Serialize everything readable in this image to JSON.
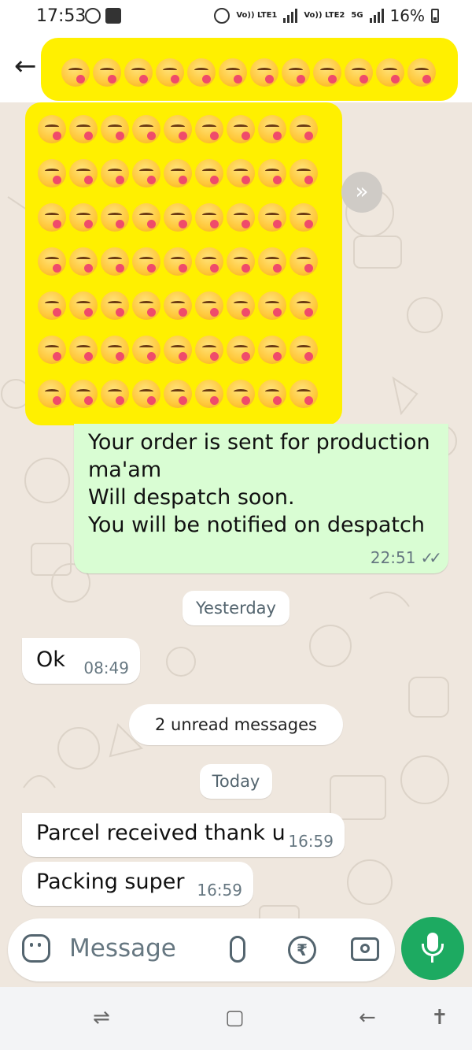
{
  "status_bar": {
    "time": "17:53",
    "sim1_label": "Vo)) LTE1",
    "sim2_label": "Vo)) LTE2",
    "network": "5G",
    "battery": "16%"
  },
  "header": {
    "back_icon": "arrow-left-icon"
  },
  "messages": {
    "outgoing_1": {
      "lines": [
        "Your order is sent for production",
        "ma'am",
        "Will despatch soon.",
        "You will be notified on despatch"
      ],
      "time": "22:51"
    },
    "yesterday_label": "Yesterday",
    "incoming_ok": {
      "text": "Ok",
      "time": "08:49"
    },
    "unread_label": "2 unread messages",
    "today_label": "Today",
    "incoming_parcel": {
      "text": "Parcel received thank u",
      "time": "16:59"
    },
    "incoming_packing": {
      "text": "Packing super",
      "time": "16:59"
    }
  },
  "input": {
    "placeholder": "Message",
    "icons": [
      "sticker-icon",
      "attach-icon",
      "rupee-icon",
      "camera-icon",
      "mic-icon"
    ]
  },
  "colors": {
    "highlight": "#fff000",
    "outgoing_bubble": "#d9fdd3",
    "mic_button": "#1daa61"
  }
}
